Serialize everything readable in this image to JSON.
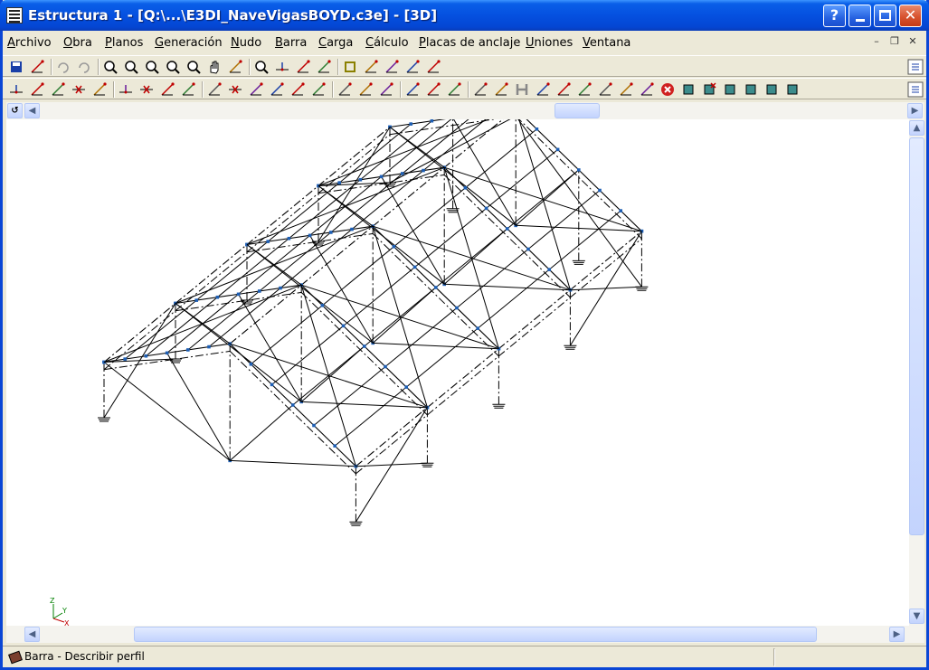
{
  "window": {
    "title": "Estructura 1 - [Q:\\...\\E3DI_NaveVigasBOYD.c3e] - [3D]"
  },
  "menu": {
    "items": [
      "Archivo",
      "Obra",
      "Planos",
      "Generación",
      "Nudo",
      "Barra",
      "Carga",
      "Cálculo",
      "Placas de anclaje",
      "Uniones",
      "Ventana"
    ]
  },
  "status": {
    "text": "Barra - Describir perfil"
  },
  "axes": {
    "z": "Z",
    "y": "Y",
    "x": "X"
  },
  "colors": {
    "title_blue": "#0550E0",
    "close_red": "#D8532F",
    "node_blue": "#1E5FB4"
  },
  "icons": {
    "toolbar1": [
      "save-icon",
      "export-icon",
      "undo-icon",
      "redo-icon",
      "zoom-select-icon",
      "zoom-all-icon",
      "zoom-window-icon",
      "zoom-in-icon",
      "zoom-out-icon",
      "pan-hand-icon",
      "view-icon",
      "binoculars-icon",
      "node-axes-icon",
      "support-icon",
      "dimension-icon",
      "square-icon",
      "grid-icon",
      "render-icon",
      "ruler-icon",
      "tools-icon"
    ],
    "toolbar2": [
      "new-node-icon",
      "dimension-bar-icon",
      "select-icon",
      "delete-node-icon",
      "visibility-icon",
      "add-node-icon",
      "remove-node-icon",
      "describe-bar-icon",
      "describe-bar-2-icon",
      "split-bar-icon",
      "delete-bar-icon",
      "bar-profile-icon",
      "buckling-icon",
      "deflection-icon",
      "lateral-icon",
      "beam-icon",
      "bar-group-icon",
      "load-icon",
      "load-2-icon",
      "load-3-icon",
      "check-icon",
      "frame-icon",
      "truss-icon",
      "h-profile-icon",
      "weld-icon",
      "joint-icon",
      "joint-2-icon",
      "bolt-icon",
      "report-icon",
      "check-disabled-icon",
      "error-icon",
      "plate-icon",
      "plate-delete-icon",
      "plate-edit-icon",
      "plate-copy-icon",
      "plate-info-icon",
      "plate-view-icon"
    ]
  }
}
